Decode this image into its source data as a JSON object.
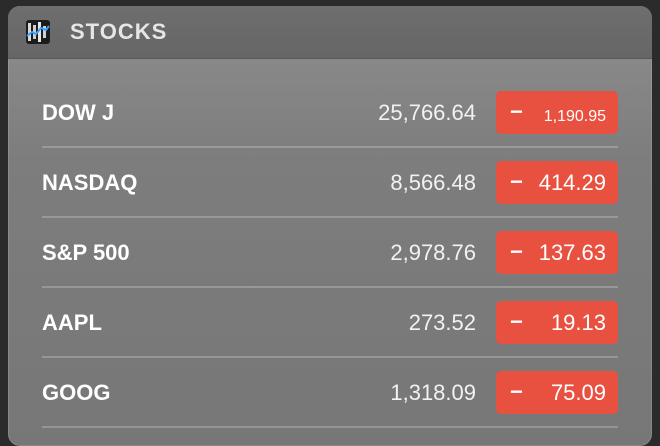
{
  "header": {
    "title": "STOCKS",
    "icon": "stocks-app-icon"
  },
  "colors": {
    "negative": "#e8503f"
  },
  "stocks": [
    {
      "symbol": "DOW J",
      "price": "25,766.64",
      "change_sign": "−",
      "change": "1,190.95"
    },
    {
      "symbol": "NASDAQ",
      "price": "8,566.48",
      "change_sign": "−",
      "change": "414.29"
    },
    {
      "symbol": "S&P 500",
      "price": "2,978.76",
      "change_sign": "−",
      "change": "137.63"
    },
    {
      "symbol": "AAPL",
      "price": "273.52",
      "change_sign": "−",
      "change": "19.13"
    },
    {
      "symbol": "GOOG",
      "price": "1,318.09",
      "change_sign": "−",
      "change": "75.09"
    }
  ]
}
